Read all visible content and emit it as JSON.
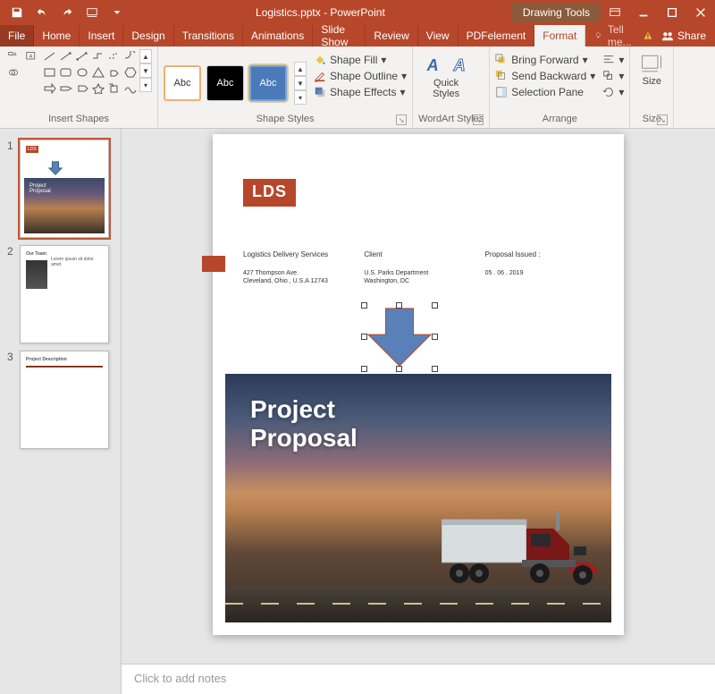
{
  "title": "Logistics.pptx - PowerPoint",
  "context_tab": "Drawing Tools",
  "tabs": {
    "file": "File",
    "home": "Home",
    "insert": "Insert",
    "design": "Design",
    "transitions": "Transitions",
    "animations": "Animations",
    "slideshow": "Slide Show",
    "review": "Review",
    "view": "View",
    "pdfelement": "PDFelement",
    "format": "Format",
    "tellme": "Tell me...",
    "share": "Share"
  },
  "ribbon": {
    "insert_shapes": "Insert Shapes",
    "shape_styles": "Shape Styles",
    "wordart_styles": "WordArt Styles",
    "arrange": "Arrange",
    "size": "Size",
    "abc": "Abc",
    "shape_fill": "Shape Fill",
    "shape_outline": "Shape Outline",
    "shape_effects": "Shape Effects",
    "quick_styles": "Quick\nStyles",
    "bring_forward": "Bring Forward",
    "send_backward": "Send Backward",
    "selection_pane": "Selection Pane",
    "size_btn": "Size",
    "wa_letter": "A"
  },
  "thumbs": {
    "n1": "1",
    "n2": "2",
    "n3": "3"
  },
  "slide": {
    "logo": "LDS",
    "company_name": "Logistics Delivery Services",
    "company_addr1": "427 Thompson Ave.",
    "company_addr2": "Cleveland, Ohio , U.S.A 12743",
    "client_hd": "Client",
    "client_addr1": "U.S. Parks Department",
    "client_addr2": "Washington, DC",
    "issued_hd": "Proposal Issued :",
    "issued_date": "05 . 06 . 2019",
    "hero_title": "Project\nProposal"
  },
  "notes_placeholder": "Click to add notes"
}
